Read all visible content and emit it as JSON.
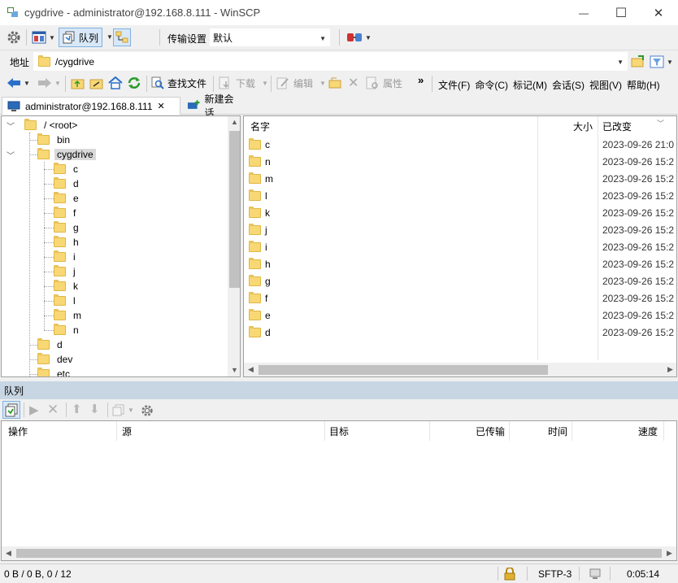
{
  "window": {
    "title": "cygdrive - administrator@192.168.8.111 - WinSCP",
    "minimize": "—",
    "maximize": "☐",
    "close": "✕"
  },
  "toolbar1": {
    "queue_label": "队列",
    "transfer_settings_label": "传输设置",
    "transfer_settings_value": "默认"
  },
  "address": {
    "label": "地址",
    "path": "/cygdrive"
  },
  "toolbar2": {
    "find_files": "查找文件",
    "download": "下载",
    "edit": "编辑",
    "properties": "属性",
    "more": "»"
  },
  "menu": [
    "文件(F)",
    "命令(C)",
    "标记(M)",
    "会话(S)",
    "视图(V)",
    "帮助(H)"
  ],
  "tabs": {
    "session": "administrator@192.168.8.111",
    "session_close": "✕",
    "new_session": "新建会话"
  },
  "tree": {
    "root": "/ <root>",
    "items": [
      {
        "label": "bin",
        "level": 1
      },
      {
        "label": "cygdrive",
        "level": 1,
        "expanded": true,
        "selected": true
      },
      {
        "label": "c",
        "level": 2
      },
      {
        "label": "d",
        "level": 2
      },
      {
        "label": "e",
        "level": 2
      },
      {
        "label": "f",
        "level": 2
      },
      {
        "label": "g",
        "level": 2
      },
      {
        "label": "h",
        "level": 2
      },
      {
        "label": "i",
        "level": 2
      },
      {
        "label": "j",
        "level": 2
      },
      {
        "label": "k",
        "level": 2
      },
      {
        "label": "l",
        "level": 2
      },
      {
        "label": "m",
        "level": 2
      },
      {
        "label": "n",
        "level": 2
      },
      {
        "label": "d",
        "level": 1
      },
      {
        "label": "dev",
        "level": 1
      },
      {
        "label": "etc",
        "level": 1
      }
    ]
  },
  "filelist": {
    "columns": {
      "name": "名字",
      "size": "大小",
      "changed": "已改变"
    },
    "rows": [
      {
        "name": "c",
        "changed": "2023-09-26 21:0"
      },
      {
        "name": "n",
        "changed": "2023-09-26 15:2"
      },
      {
        "name": "m",
        "changed": "2023-09-26 15:2"
      },
      {
        "name": "l",
        "changed": "2023-09-26 15:2"
      },
      {
        "name": "k",
        "changed": "2023-09-26 15:2"
      },
      {
        "name": "j",
        "changed": "2023-09-26 15:2"
      },
      {
        "name": "i",
        "changed": "2023-09-26 15:2"
      },
      {
        "name": "h",
        "changed": "2023-09-26 15:2"
      },
      {
        "name": "g",
        "changed": "2023-09-26 15:2"
      },
      {
        "name": "f",
        "changed": "2023-09-26 15:2"
      },
      {
        "name": "e",
        "changed": "2023-09-26 15:2"
      },
      {
        "name": "d",
        "changed": "2023-09-26 15:2"
      }
    ]
  },
  "queue": {
    "title": "队列",
    "columns": {
      "operation": "操作",
      "source": "源",
      "target": "目标",
      "transferred": "已传输",
      "time": "时间",
      "speed": "速度"
    }
  },
  "status": {
    "bytes": "0 B / 0 B,   0 / 12",
    "protocol": "SFTP-3",
    "elapsed": "0:05:14"
  },
  "colors": {
    "queue_header": "#c8d6e3",
    "folder": "#f8d775",
    "accent_blue": "#1e6fc7"
  }
}
